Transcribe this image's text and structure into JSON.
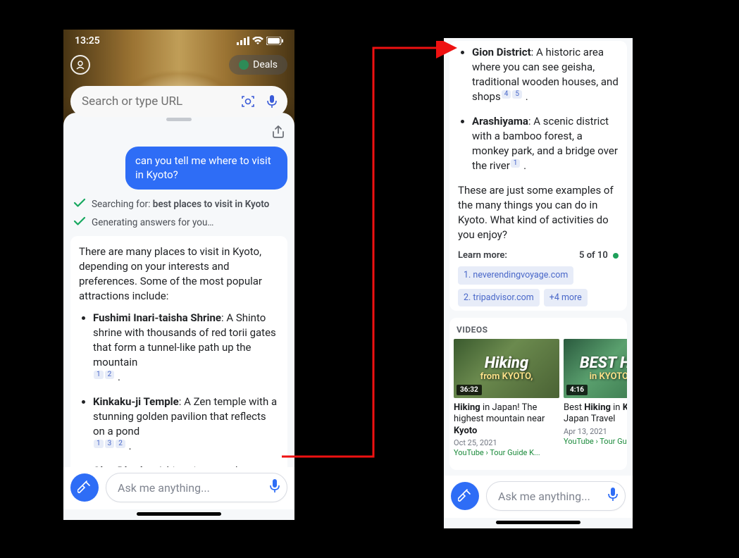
{
  "statusbar": {
    "time": "13:25"
  },
  "hero": {
    "deals_label": "Deals",
    "search_placeholder": "Search or type URL"
  },
  "chat": {
    "user_msg": "can you tell me where to visit in Kyoto?",
    "searching_prefix": "Searching for: ",
    "searching_query": "best places to visit in Kyoto",
    "generating": "Generating answers for you…",
    "intro": "There are many places to visit in Kyoto, depending on your interests and preferences. Some of the most popular attractions include:",
    "items": [
      {
        "title": "Fushimi Inari-taisha Shrine",
        "text": ": A Shinto shrine with thousands of red torii gates that form a tunnel-like path up the mountain",
        "cites": [
          "1",
          "2"
        ]
      },
      {
        "title": "Kinkaku-ji Temple",
        "text": ": A Zen temple with a stunning golden pavilion that reflects on a pond",
        "cites": [
          "1",
          "3",
          "2"
        ]
      },
      {
        "title": "Gion District",
        "text": ": A historic area where you can see geisha,",
        "cites": []
      }
    ],
    "ask_placeholder": "Ask me anything..."
  },
  "chat2": {
    "items": [
      {
        "title": "Gion District",
        "text": ": A historic area where you can see geisha, traditional wooden houses, and shops",
        "cites": [
          "4",
          "5"
        ]
      },
      {
        "title": "Arashiyama",
        "text": ": A scenic district with a bamboo forest, a monkey park, and a bridge over the river",
        "cites": [
          "1"
        ]
      }
    ],
    "outro": "These are just some examples of the many things you can do in Kyoto. What kind of activities do you enjoy?",
    "learn_more_label": "Learn more:",
    "counter": "5 of 10",
    "pills": [
      "1. neverendingvoyage.com",
      "2. tripadvisor.com",
      "+4 more"
    ]
  },
  "videos": {
    "header": "VIDEOS",
    "items": [
      {
        "thumb_line1": "Hiking",
        "thumb_line2": "from KYOTO,",
        "duration": "36:32",
        "title_pre": "",
        "title_b": "Hiking",
        "title_mid": " in Japan! The highest mountain near ",
        "title_b2": "Kyoto",
        "date": "Oct 25, 2021",
        "source": "YouTube › Tour Guide K..."
      },
      {
        "thumb_line1": "BEST HIKE",
        "thumb_line2": "in KYOTO, JA",
        "duration": "4:16",
        "title_pre": "Best ",
        "title_b": "Hiking",
        "title_mid": " in ",
        "title_b2": "Ky",
        "title_post": "Japan Travel",
        "date": "Apr 13, 2021",
        "source": "YouTube › Tour Guid"
      }
    ]
  }
}
